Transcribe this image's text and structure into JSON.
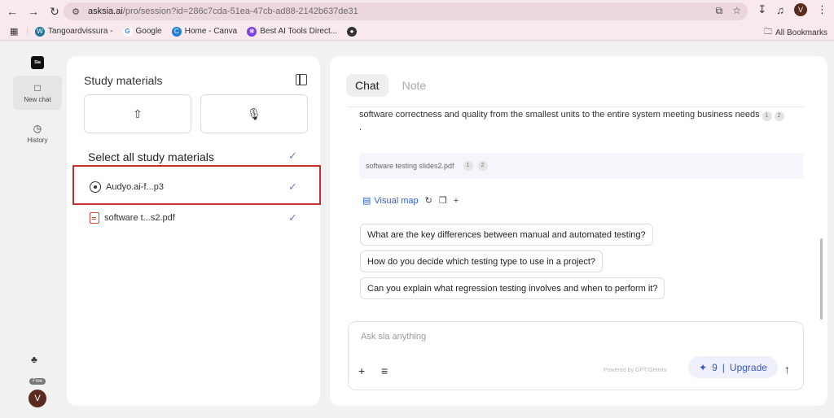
{
  "browser": {
    "url_host": "asksia.ai",
    "url_path": "/pro/session?id=286c7cda-51ea-47cb-ad88-2142b637de31",
    "profile_initial": "V",
    "bookmarks": [
      "Tangoardvissura -",
      "Google",
      "Home - Canva",
      "Best AI Tools Direct..."
    ],
    "all_bookmarks": "All Bookmarks"
  },
  "rail": {
    "logo": "Sia",
    "new_chat": "New chat",
    "history": "History",
    "plan_badge": "Free",
    "user_initial": "V"
  },
  "study": {
    "title": "Study materials",
    "select_all": "Select all study materials",
    "items": [
      {
        "name": "Audyo.ai-f...p3",
        "type": "audio-icon"
      },
      {
        "name": "software t...s2.pdf",
        "type": "pdf-icon"
      }
    ]
  },
  "chat": {
    "tabs": [
      "Chat",
      "Note"
    ],
    "answer_text": "software correctness and quality from the smallest units to the entire system meeting business needs",
    "answer_tail": ".",
    "answer_cites": [
      "1",
      "2"
    ],
    "source_file": "software testing slides2.pdf",
    "source_cites": [
      "1",
      "2"
    ],
    "visual_map": "Visual map",
    "suggestions": [
      "What are the key differences between manual and automated testing?",
      "How do you decide which testing type to use in a project?",
      "Can you explain what regression testing involves and when to perform it?"
    ],
    "input_placeholder": "Ask sia anything",
    "powered_by": "Powered by GPT/Gemini",
    "credits": "9",
    "upgrade_label": "Upgrade"
  },
  "colors": {
    "accent": "#3b56c4",
    "highlight_border": "#c9302c",
    "check": "#6b7fd0"
  }
}
